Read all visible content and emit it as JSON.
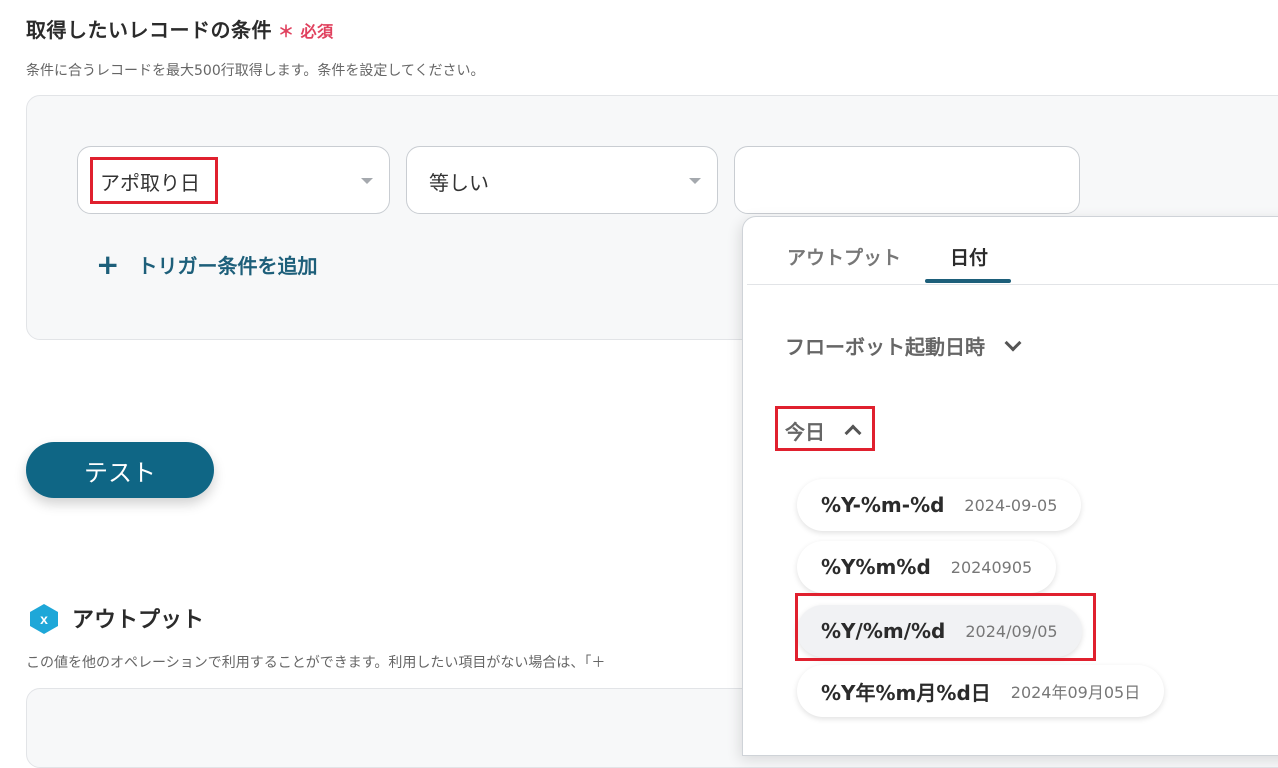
{
  "section": {
    "title": "取得したいレコードの条件",
    "required_mark": "＊",
    "required_label": "必須",
    "description": "条件に合うレコードを最大500行取得します。条件を設定してください。"
  },
  "condition": {
    "field": "アポ取り日",
    "operator": "等しい",
    "value": "",
    "add_label": "トリガー条件を追加",
    "add_icon": "+"
  },
  "test_button": "テスト",
  "output": {
    "title": "アウトプット",
    "icon_glyph": "x",
    "description": "この値を他のオペレーションで利用することができます。利用したい項目がない場合は、「＋"
  },
  "picker": {
    "tabs": [
      {
        "label": "アウトプット",
        "active": false
      },
      {
        "label": "日付",
        "active": true
      }
    ],
    "group_flowbot": "フローボット起動日時",
    "group_today": "今日",
    "formats": [
      {
        "pattern": "%Y-%m-%d",
        "example": "2024-09-05"
      },
      {
        "pattern": "%Y%m%d",
        "example": "20240905"
      },
      {
        "pattern": "%Y/%m/%d",
        "example": "2024/09/05"
      },
      {
        "pattern": "%Y年%m月%d日",
        "example": "2024年09月05日"
      }
    ]
  },
  "colors": {
    "accent": "#1d5f7a",
    "button": "#0f6685",
    "required": "#e0415e",
    "highlight": "#e0202e",
    "output_icon": "#1ea7d8"
  }
}
